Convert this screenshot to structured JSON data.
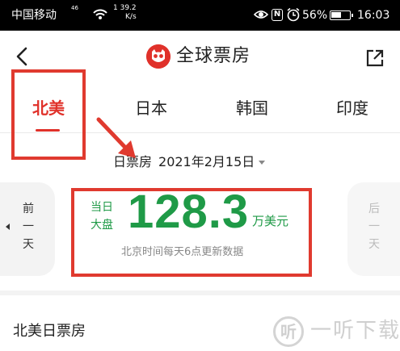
{
  "status_bar": {
    "carrier": "中国移动",
    "signal": "46",
    "net_speed_value": "39.2",
    "net_speed_unit": "K/s",
    "network_icon_prefix": "1",
    "battery_percent": "56%",
    "battery_level": 0.56,
    "time": "16:03",
    "nfc_label": "N",
    "icons": [
      "wifi-icon",
      "eye-icon",
      "nfc-icon",
      "alarm-icon",
      "battery-icon"
    ]
  },
  "header": {
    "title": "全球票房",
    "back_icon": "chevron-left-icon",
    "logo_icon": "cat-eye-logo-icon",
    "share_icon": "external-link-icon"
  },
  "tabs": [
    {
      "label": "北美",
      "active": true
    },
    {
      "label": "日本",
      "active": false
    },
    {
      "label": "韩国",
      "active": false
    },
    {
      "label": "印度",
      "active": false
    }
  ],
  "date_selector": {
    "label": "日票房",
    "date": "2021年2月15日"
  },
  "nav": {
    "prev": [
      "前",
      "一",
      "天"
    ],
    "next": [
      "后",
      "一",
      "天"
    ]
  },
  "kpi": {
    "label_line1": "当日",
    "label_line2": "大盘",
    "value": "128.3",
    "unit": "万美元",
    "note": "北京时间每天6点更新数据"
  },
  "section": {
    "title": "北美日票房"
  },
  "watermark": {
    "badge": "听",
    "text": "一听下载"
  },
  "colors": {
    "accent_red": "#e0312a",
    "value_green": "#1f9a47",
    "annotation_red": "#e03a2f"
  }
}
